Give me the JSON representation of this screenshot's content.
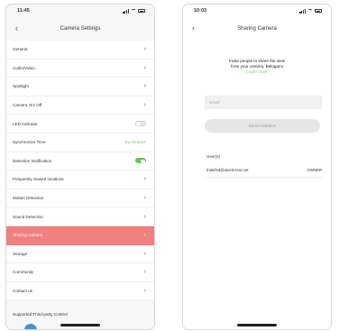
{
  "left": {
    "status": {
      "time": "11:45"
    },
    "title": "Camera Settings",
    "rows": [
      {
        "label": "General",
        "type": "chevron"
      },
      {
        "label": "Audio/Video",
        "type": "chevron"
      },
      {
        "label": "Spotlight",
        "type": "chevron"
      },
      {
        "label": "Camera On/ Off",
        "type": "chevron"
      },
      {
        "label": "LED Indicator",
        "type": "toggle",
        "on": false
      },
      {
        "label": "Synchronize Time",
        "type": "value",
        "value": "Synchronize"
      },
      {
        "label": "Detection Notification",
        "type": "toggle",
        "on": true
      },
      {
        "label": "Frequently viewed locations",
        "type": "chevron"
      },
      {
        "label": "Motion Detection",
        "type": "chevron"
      },
      {
        "label": "Sound Detection",
        "type": "chevron"
      },
      {
        "label": "Sharing Camera",
        "type": "chevron",
        "highlight": true
      },
      {
        "label": "Storage",
        "type": "chevron"
      },
      {
        "label": "Community",
        "type": "chevron"
      },
      {
        "label": "Contact us",
        "type": "chevron"
      }
    ],
    "footer": "Supported Third-party Control"
  },
  "right": {
    "status": {
      "time": "10:03"
    },
    "title": "Sharing Camera",
    "invite_line1": "Invite people to share the view",
    "invite_line2": "from your camera. Belogami",
    "learn_more": "Learn more",
    "email_placeholder": "Email",
    "send_button": "Send Invitation",
    "users_label": "User(s)",
    "user_email": "trialofed@aiuelo.test.net",
    "user_role": "OWNER"
  },
  "colors": {
    "accent": "#f07f80",
    "green": "#6fc35b"
  }
}
